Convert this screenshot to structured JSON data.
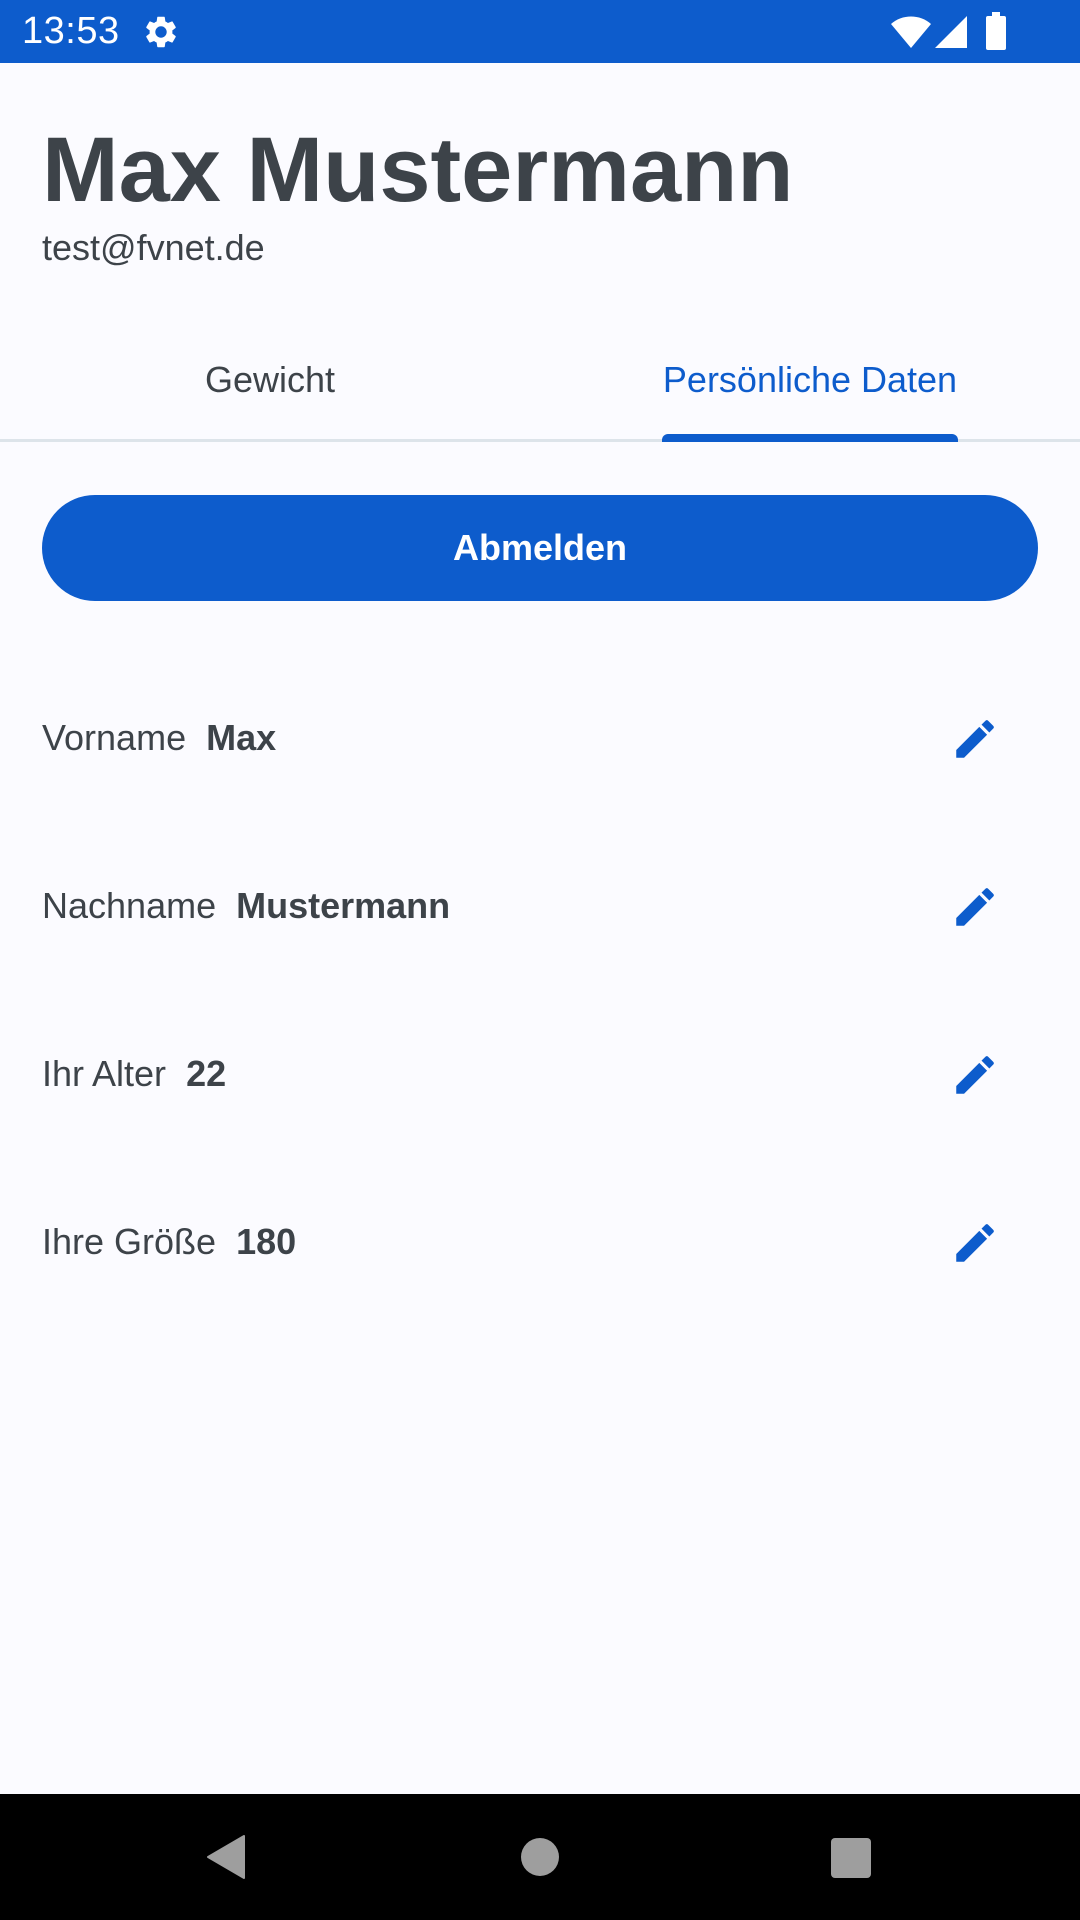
{
  "status_bar": {
    "time": "13:53",
    "icons": [
      "gear-icon",
      "wifi-icon",
      "signal-icon",
      "battery-icon"
    ],
    "background": "#0d5ccc"
  },
  "profile": {
    "name": "Max Mustermann",
    "email": "test@fvnet.de"
  },
  "tabs": [
    {
      "label": "Gewicht",
      "active": false
    },
    {
      "label": "Persönliche Daten",
      "active": true
    }
  ],
  "logout_label": "Abmelden",
  "fields": [
    {
      "label": "Vorname",
      "value": "Max",
      "icon": "pencil-icon"
    },
    {
      "label": "Nachname",
      "value": "Mustermann",
      "icon": "pencil-icon"
    },
    {
      "label": "Ihr Alter",
      "value": "22",
      "icon": "pencil-icon"
    },
    {
      "label": "Ihre Größe",
      "value": "180",
      "icon": "pencil-icon"
    }
  ],
  "nav_bar": {
    "icons": [
      "back-icon",
      "home-icon",
      "recents-icon"
    ]
  },
  "colors": {
    "accent": "#0d5ccc",
    "text": "#3d4349",
    "background": "#fbfbff",
    "divider": "#dde4ea"
  }
}
